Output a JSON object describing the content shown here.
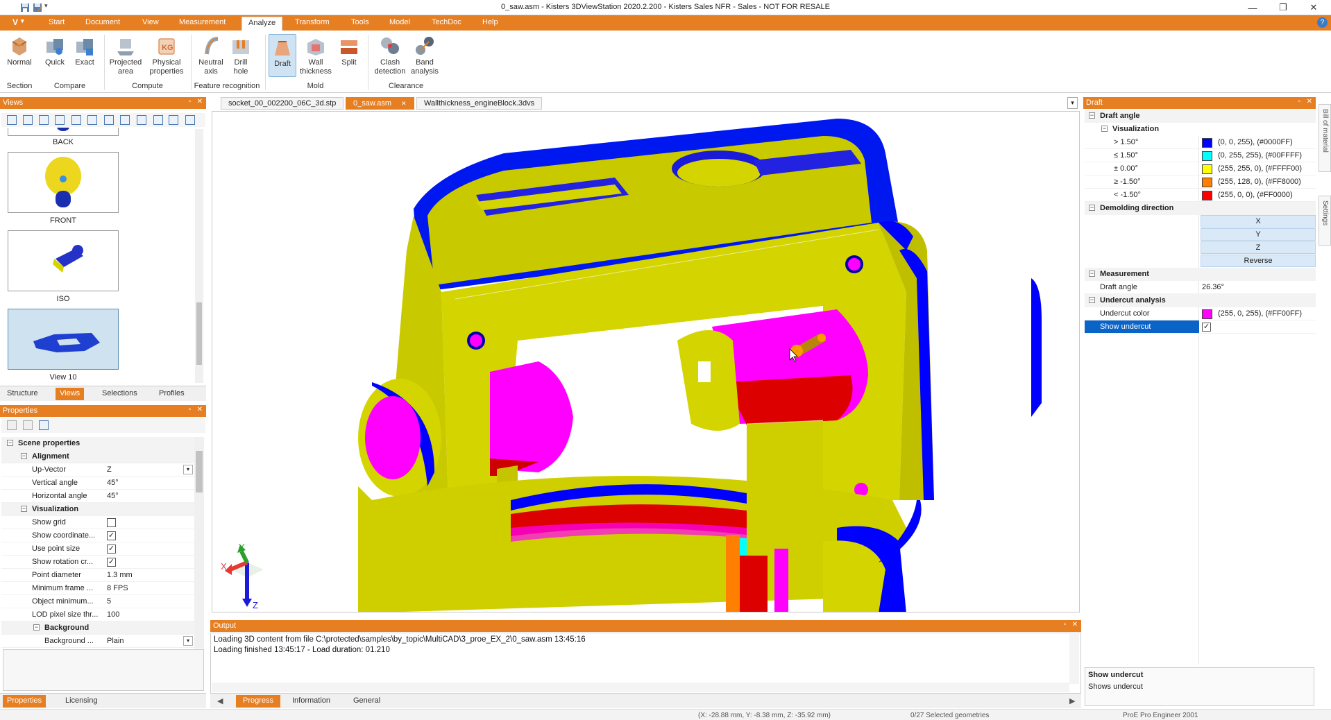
{
  "window": {
    "title": "0_saw.asm - Kisters 3DViewStation 2020.2.200 - Kisters Sales NFR - Sales - NOT FOR RESALE",
    "controls": [
      "—",
      "❐",
      "✕"
    ]
  },
  "menubar": {
    "app_button": "V",
    "items": [
      "Start",
      "Document",
      "View",
      "Measurement",
      "Analyze",
      "Transform",
      "Tools",
      "Model",
      "TechDoc",
      "Help"
    ],
    "active": "Analyze",
    "help_icon": "?"
  },
  "ribbon": {
    "buttons": [
      {
        "label": "Normal",
        "label2": "",
        "icon": "normal-section-icon",
        "group": "Section"
      },
      {
        "label": "Quick",
        "label2": "",
        "icon": "quick-compare-icon",
        "group": "Compare"
      },
      {
        "label": "Exact",
        "label2": "",
        "icon": "exact-compare-icon",
        "group": "Compare"
      },
      {
        "label": "Projected",
        "label2": "area",
        "icon": "projected-area-icon",
        "group": "Compute"
      },
      {
        "label": "Physical",
        "label2": "properties",
        "icon": "physical-properties-icon",
        "group": "Compute"
      },
      {
        "label": "Neutral",
        "label2": "axis",
        "icon": "neutral-axis-icon",
        "group": "Feature recognition"
      },
      {
        "label": "Drill",
        "label2": "hole",
        "icon": "drill-hole-icon",
        "group": "Feature recognition"
      },
      {
        "label": "Draft",
        "label2": "",
        "icon": "draft-icon",
        "group": "Mold"
      },
      {
        "label": "Wall",
        "label2": "thickness",
        "icon": "wall-thickness-icon",
        "group": "Mold"
      },
      {
        "label": "Split",
        "label2": "",
        "icon": "split-icon",
        "group": "Mold"
      },
      {
        "label": "Clash",
        "label2": "detection",
        "icon": "clash-detection-icon",
        "group": "Clearance"
      },
      {
        "label": "Band",
        "label2": "analysis",
        "icon": "band-analysis-icon",
        "group": "Clearance"
      }
    ],
    "groups": [
      "Section",
      "Compare",
      "Compute",
      "Feature recognition",
      "Mold",
      "Clearance"
    ]
  },
  "views_panel": {
    "title": "Views",
    "thumbnails": [
      "BACK",
      "FRONT",
      "ISO",
      "View 10"
    ],
    "tabs": [
      "Structure",
      "Views",
      "Selections",
      "Profiles"
    ],
    "active_tab": "Views"
  },
  "properties_panel": {
    "title": "Properties",
    "root": "Scene properties",
    "sections": {
      "alignment": "Alignment",
      "visualization": "Visualization",
      "background": "Background"
    },
    "rows": {
      "up_vector": {
        "label": "Up-Vector",
        "value": "Z"
      },
      "vertical_angle": {
        "label": "Vertical angle",
        "value": "45°"
      },
      "horizontal_angle": {
        "label": "Horizontal angle",
        "value": "45°"
      },
      "show_grid": {
        "label": "Show grid",
        "checked": false
      },
      "show_coordinate": {
        "label": "Show coordinate...",
        "checked": true
      },
      "use_point_size": {
        "label": "Use point size",
        "checked": true
      },
      "show_rotation": {
        "label": "Show rotation cr...",
        "checked": true
      },
      "point_diameter": {
        "label": "Point diameter",
        "value": "1.3 mm"
      },
      "minimum_frame": {
        "label": "Minimum frame ...",
        "value": "8 FPS"
      },
      "object_minimum": {
        "label": "Object minimum...",
        "value": "5"
      },
      "lod_pixel": {
        "label": "LOD pixel size thr...",
        "value": "100"
      },
      "background_mode": {
        "label": "Background ...",
        "value": "Plain"
      }
    },
    "tabs": [
      "Properties",
      "Licensing"
    ],
    "active_tab": "Properties"
  },
  "documents": {
    "tabs": [
      "socket_00_002200_06C_3d.stp",
      "0_saw.asm",
      "Wallthickness_engineBlock.3dvs"
    ],
    "active": "0_saw.asm"
  },
  "triad": {
    "x": "X",
    "y": "Y",
    "z": "Z"
  },
  "output_panel": {
    "title": "Output",
    "lines": [
      "Loading 3D content from file C:\\protected\\samples\\by_topic\\MultiCAD\\3_proe_EX_2\\0_saw.asm 13:45:16",
      "Loading finished 13:45:17 - Load duration: 01.210"
    ],
    "tabs": [
      "Progress",
      "Information",
      "General"
    ],
    "active_tab": "Progress"
  },
  "draft_panel": {
    "title": "Draft",
    "draft_angle_section": "Draft angle",
    "visualization_section": "Visualization",
    "legend": [
      {
        "label": "> 1.50°",
        "color": "#0000FF",
        "text": "(0, 0, 255), (#0000FF)"
      },
      {
        "label": "≤ 1.50°",
        "color": "#00FFFF",
        "text": "(0, 255, 255), (#00FFFF)"
      },
      {
        "label": "± 0.00°",
        "color": "#FFFF00",
        "text": "(255, 255, 0), (#FFFF00)"
      },
      {
        "label": "≥ -1.50°",
        "color": "#FF8000",
        "text": "(255, 128, 0), (#FF8000)"
      },
      {
        "label": "< -1.50°",
        "color": "#FF0000",
        "text": "(255, 0, 0), (#FF0000)"
      }
    ],
    "demolding_section": "Demolding direction",
    "direction_buttons": [
      "X",
      "Y",
      "Z",
      "Reverse"
    ],
    "measurement_section": "Measurement",
    "draft_angle_label": "Draft angle",
    "draft_angle_value": "26.36°",
    "undercut_section": "Undercut analysis",
    "undercut_color_label": "Undercut color",
    "undercut_color": "#FF00FF",
    "undercut_color_text": "(255, 0, 255), (#FF00FF)",
    "show_undercut_label": "Show undercut",
    "show_undercut_checked": true,
    "help_title": "Show undercut",
    "help_text": "Shows undercut"
  },
  "side_tabs": [
    "Bill of material",
    "Settings"
  ],
  "statusbar": {
    "coords": "(X: -28.88 mm, Y: -8.38 mm, Z: -35.92 mm)",
    "selection": "0/27 Selected geometries",
    "format": "ProE Pro Engineer 2001"
  },
  "colors": {
    "accent": "#E67E22",
    "model_yellow": "#D4D400",
    "model_blue": "#0000FF",
    "model_magenta": "#FF00FF",
    "model_red": "#DD0000"
  }
}
